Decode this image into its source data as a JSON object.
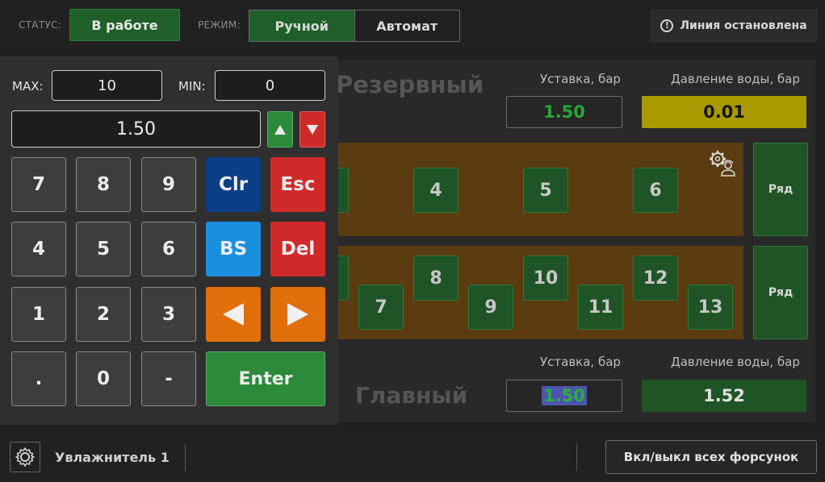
{
  "header": {
    "status_label": "СТАТУС:",
    "status_value": "В работе",
    "mode_label": "РЕЖИМ:",
    "mode_manual": "Ручной",
    "mode_auto": "Автомат",
    "line_status": "Линия остановлена",
    "info_icon": "info-icon"
  },
  "reserve": {
    "title": "Резервный",
    "setpoint_label": "Уставка, бар",
    "setpoint_value": "1.50",
    "pressure_label": "Давление воды, бар",
    "pressure_value": "0.01",
    "pressure_color": "#a89a00"
  },
  "rows": [
    {
      "row_label": "Ряд",
      "nozzles": [
        "4",
        "5",
        "6"
      ],
      "service_icon": "technician-gear-icon"
    },
    {
      "row_label": "Ряд",
      "nozzles": [
        "7",
        "8",
        "9",
        "10",
        "11",
        "12",
        "13"
      ]
    }
  ],
  "main_pump": {
    "title": "Главный",
    "setpoint_label": "Уставка, бар",
    "setpoint_value": "1.50",
    "pressure_label": "Давление воды, бар",
    "pressure_value": "1.52",
    "pressure_color": "#1f5426"
  },
  "keypad": {
    "max_label": "MAX:",
    "max_value": "10",
    "min_label": "MIN:",
    "min_value": "0",
    "display_value": "1.50",
    "keys": {
      "k7": "7",
      "k8": "8",
      "k9": "9",
      "clr": "Clr",
      "esc": "Esc",
      "k4": "4",
      "k5": "5",
      "k6": "6",
      "bs": "BS",
      "del": "Del",
      "k1": "1",
      "k2": "2",
      "k3": "3",
      "dot": ".",
      "k0": "0",
      "minus": "-",
      "enter": "Enter"
    }
  },
  "footer": {
    "device_name": "Увлажнитель 1",
    "all_nozzles_button": "Вкл/выкл всех форсунок"
  }
}
